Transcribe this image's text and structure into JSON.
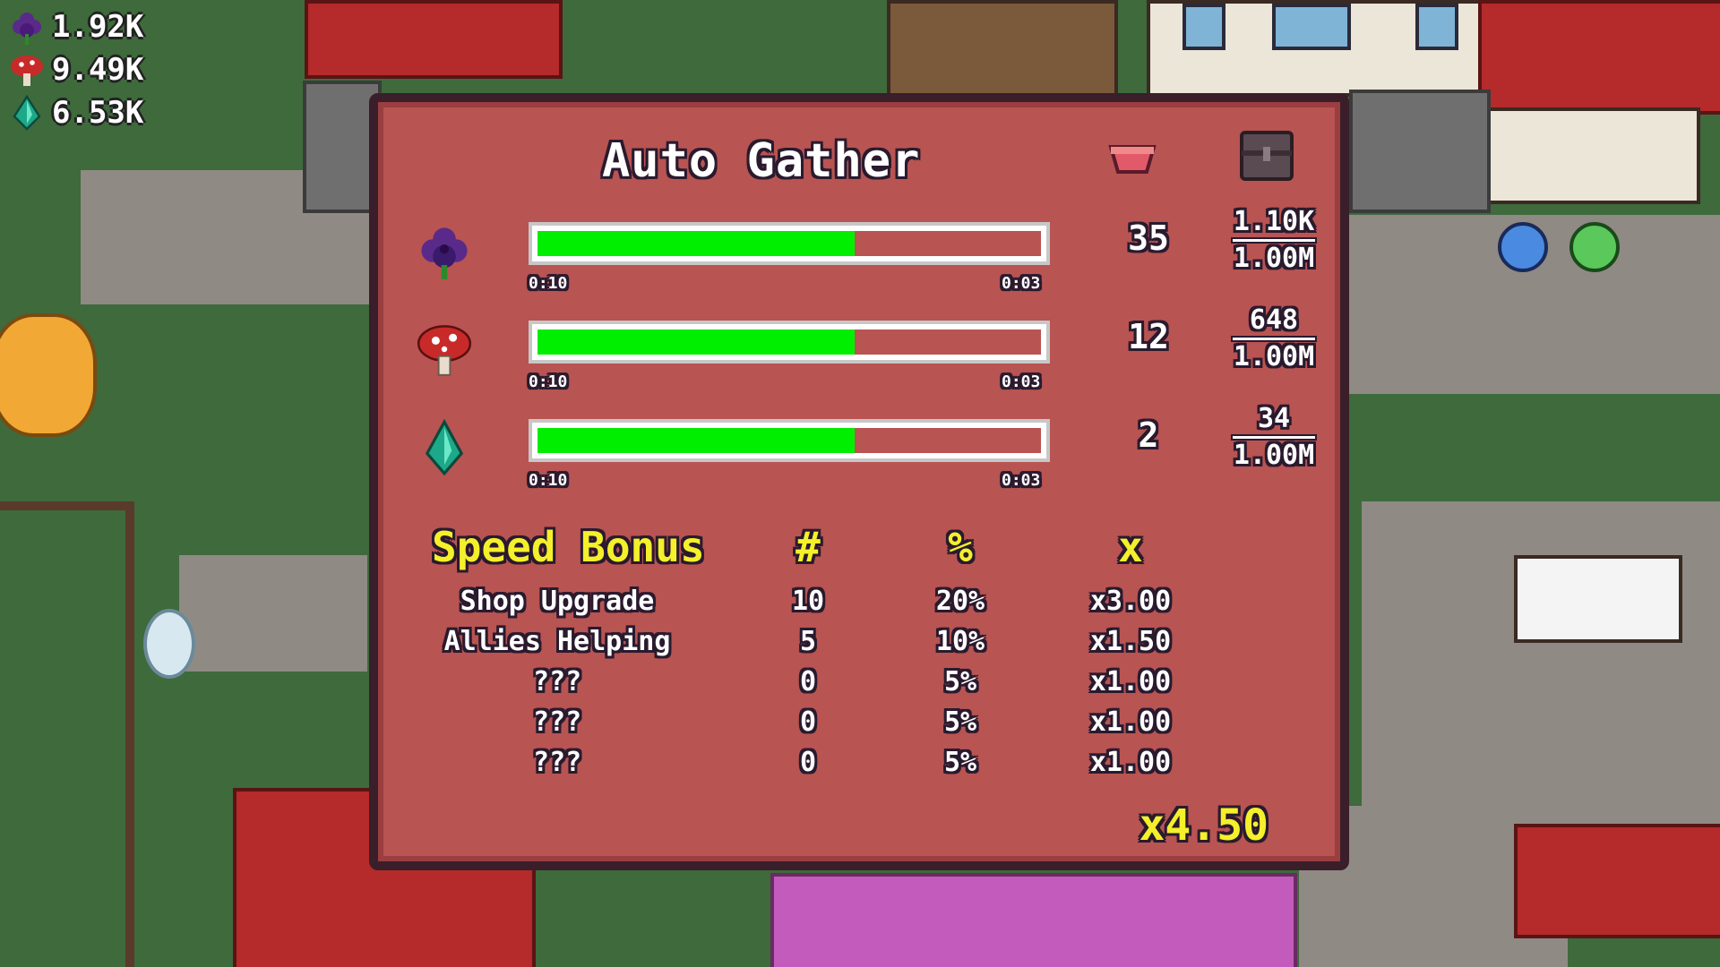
{
  "hud": {
    "resources": [
      {
        "icon": "flower-icon",
        "value": "1.92K"
      },
      {
        "icon": "mushroom-icon",
        "value": "9.49K"
      },
      {
        "icon": "crystal-icon",
        "value": "6.53K"
      }
    ]
  },
  "panel": {
    "title": "Auto Gather",
    "header_icons": [
      "basket-icon",
      "chest-icon"
    ],
    "resources": [
      {
        "icon": "flower-icon",
        "fill_fraction": 0.63,
        "time_left": "0:10",
        "time_right": "0:03",
        "count": "35",
        "stored": "1.10K",
        "capacity": "1.00M"
      },
      {
        "icon": "mushroom-icon",
        "fill_fraction": 0.63,
        "time_left": "0:10",
        "time_right": "0:03",
        "count": "12",
        "stored": "648",
        "capacity": "1.00M"
      },
      {
        "icon": "crystal-icon",
        "fill_fraction": 0.63,
        "time_left": "0:10",
        "time_right": "0:03",
        "count": "2",
        "stored": "34",
        "capacity": "1.00M"
      }
    ],
    "speed_bonus": {
      "title": "Speed Bonus",
      "col_count": "#",
      "col_percent": "%",
      "col_mult": "x",
      "rows": [
        {
          "name": "Shop Upgrade",
          "count": "10",
          "percent": "20%",
          "mult": "x3.00"
        },
        {
          "name": "Allies Helping",
          "count": "5",
          "percent": "10%",
          "mult": "x1.50"
        },
        {
          "name": "???",
          "count": "0",
          "percent": "5%",
          "mult": "x1.00"
        },
        {
          "name": "???",
          "count": "0",
          "percent": "5%",
          "mult": "x1.00"
        },
        {
          "name": "???",
          "count": "0",
          "percent": "5%",
          "mult": "x1.00"
        }
      ],
      "total": "x4.50"
    }
  },
  "colors": {
    "panel_bg": "#b85452",
    "bar_fill": "#00ee00",
    "accent_yellow": "#f4f02a"
  }
}
